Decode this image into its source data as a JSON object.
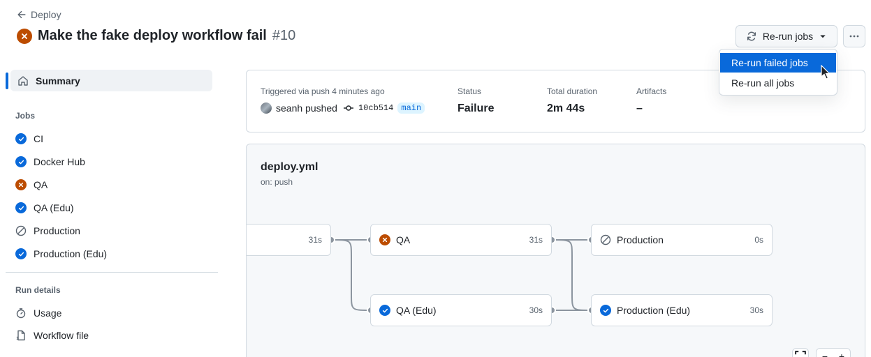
{
  "header": {
    "back_label": "Deploy",
    "run_title": "Make the fake deploy workflow fail",
    "run_number": "#10",
    "rerun_label": "Re-run jobs"
  },
  "rerun_menu": {
    "items": [
      {
        "label": "Re-run failed jobs",
        "active": true
      },
      {
        "label": "Re-run all jobs",
        "active": false
      }
    ]
  },
  "sidebar": {
    "summary_label": "Summary",
    "jobs_heading": "Jobs",
    "jobs": [
      {
        "label": "CI",
        "status": "success"
      },
      {
        "label": "Docker Hub",
        "status": "success"
      },
      {
        "label": "QA",
        "status": "failure"
      },
      {
        "label": "QA (Edu)",
        "status": "success"
      },
      {
        "label": "Production",
        "status": "skipped"
      },
      {
        "label": "Production (Edu)",
        "status": "success"
      }
    ],
    "run_details_heading": "Run details",
    "run_details": [
      {
        "label": "Usage",
        "icon": "stopwatch-icon"
      },
      {
        "label": "Workflow file",
        "icon": "file-icon"
      }
    ]
  },
  "summary": {
    "trigger_label": "Triggered via push 4 minutes ago",
    "actor": "seanh pushed",
    "commit": "10cb514",
    "branch": "main",
    "status_label": "Status",
    "status_value": "Failure",
    "duration_label": "Total duration",
    "duration_value": "2m 44s",
    "artifacts_label": "Artifacts",
    "artifacts_value": "–"
  },
  "graph": {
    "file": "deploy.yml",
    "trigger": "on: push",
    "nodes": [
      {
        "label": "",
        "duration": "31s",
        "status": "none"
      },
      {
        "label": "QA",
        "duration": "31s",
        "status": "failure"
      },
      {
        "label": "QA (Edu)",
        "duration": "30s",
        "status": "success"
      },
      {
        "label": "Production",
        "duration": "0s",
        "status": "skipped"
      },
      {
        "label": "Production (Edu)",
        "duration": "30s",
        "status": "success"
      }
    ]
  },
  "colors": {
    "success": "#0969da",
    "failure": "#bc4c00",
    "accent": "#0969da"
  }
}
